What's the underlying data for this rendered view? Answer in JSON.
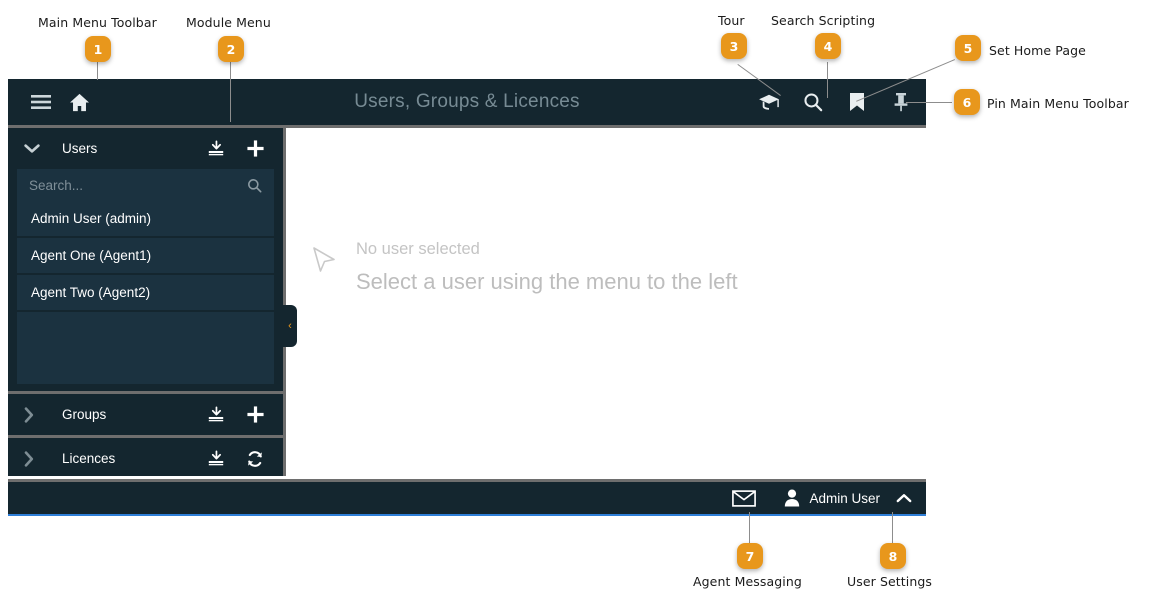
{
  "app": {
    "title": "Users, Groups & Licences",
    "toolbar_left": [
      {
        "name": "hamburger-menu-icon",
        "label": "Main Menu"
      },
      {
        "name": "home-icon",
        "label": "Home"
      }
    ],
    "toolbar_right": [
      {
        "name": "graduation-cap-icon",
        "label": "Tour"
      },
      {
        "name": "search-icon",
        "label": "Search Scripting"
      },
      {
        "name": "bookmark-icon",
        "label": "Set Home Page"
      },
      {
        "name": "pin-icon",
        "label": "Pin Main Menu Toolbar"
      }
    ]
  },
  "sidebar": {
    "panels": [
      {
        "title": "Users",
        "expanded": true,
        "caret": "⌄",
        "actions": [
          {
            "name": "import-icon",
            "label": "Import"
          },
          {
            "name": "add-icon",
            "label": "Add"
          }
        ]
      },
      {
        "title": "Groups",
        "expanded": false,
        "caret": "›",
        "actions": [
          {
            "name": "import-icon",
            "label": "Import"
          },
          {
            "name": "add-icon",
            "label": "Add"
          }
        ]
      },
      {
        "title": "Licences",
        "expanded": false,
        "caret": "›",
        "actions": [
          {
            "name": "import-icon",
            "label": "Import"
          },
          {
            "name": "refresh-icon",
            "label": "Refresh"
          }
        ]
      }
    ],
    "search": {
      "value": "",
      "placeholder": "Search..."
    },
    "users": [
      "Admin User (admin)",
      "Agent One (Agent1)",
      "Agent Two (Agent2)"
    ],
    "collapse_handle": "‹"
  },
  "content": {
    "empty_title": "No user selected",
    "empty_message": "Select a user using the menu to the left"
  },
  "statusbar": {
    "messaging_label": "Agent Messaging",
    "user_name": "Admin User",
    "caret": "⌃"
  },
  "annotations": [
    {
      "number": "1",
      "label": "Main Menu Toolbar"
    },
    {
      "number": "2",
      "label": "Module Menu"
    },
    {
      "number": "3",
      "label": "Tour"
    },
    {
      "number": "4",
      "label": "Search Scripting"
    },
    {
      "number": "5",
      "label": "Set Home Page"
    },
    {
      "number": "6",
      "label": "Pin Main Menu Toolbar"
    },
    {
      "number": "7",
      "label": "Agent Messaging"
    },
    {
      "number": "8",
      "label": "User Settings"
    }
  ],
  "colors": {
    "accent_orange": "#E8971C",
    "panel_dark": "#14262F",
    "panel_item": "#1B3240",
    "chrome_gray": "#6E6E6E",
    "status_blue": "#2F7FD8"
  }
}
